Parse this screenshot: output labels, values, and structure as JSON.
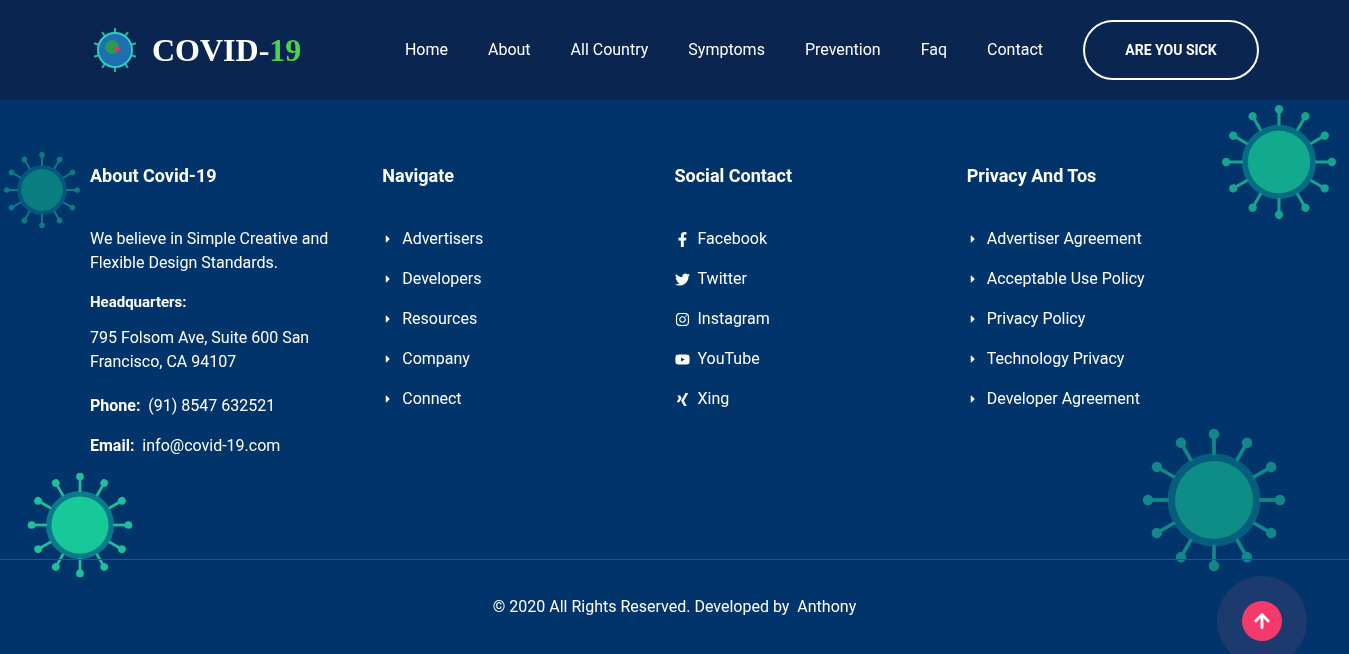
{
  "header": {
    "logo": {
      "text": "COVID-",
      "accent": "19"
    },
    "nav": [
      {
        "label": "Home",
        "selected": false
      },
      {
        "label": "About",
        "selected": false
      },
      {
        "label": "All Country",
        "selected": false
      },
      {
        "label": "Symptoms",
        "selected": false
      },
      {
        "label": "Prevention",
        "selected": false
      },
      {
        "label": "Faq",
        "selected": false
      },
      {
        "label": "Contact",
        "selected": false
      }
    ],
    "cta": "ARE YOU SICK"
  },
  "about": {
    "title": "About Covid-19",
    "text": "We believe in Simple Creative and Flexible Design Standards.",
    "hq_label": "Headquarters:",
    "address": "795 Folsom Ave, Suite 600 San Francisco, CA 94107",
    "phone": "**Phone:**  (91) 8547 632521",
    "email": "**Email:**  info@covid-19.com"
  },
  "navigate": {
    "title": "Navigate",
    "links": [
      "Advertisers",
      "Developers",
      "Resources",
      "Company",
      "Connect"
    ]
  },
  "social": {
    "title": "Social Contact",
    "links": [
      {
        "kind": "facebook",
        "label": "Facebook"
      },
      {
        "kind": "twitter",
        "label": "Twitter"
      },
      {
        "kind": "instagram",
        "label": "Instagram"
      },
      {
        "kind": "youtube",
        "label": "YouTube"
      },
      {
        "kind": "xing",
        "label": "Xing"
      }
    ]
  },
  "privacy": {
    "title": "Privacy And Tos",
    "links": [
      "Advertiser Agreement",
      "Acceptable Use Policy",
      "Privacy Policy",
      "Technology Privacy",
      "Developer Agreement"
    ]
  },
  "copyright": "© 2020 All Rights Reserved. Developed by  Anthony"
}
